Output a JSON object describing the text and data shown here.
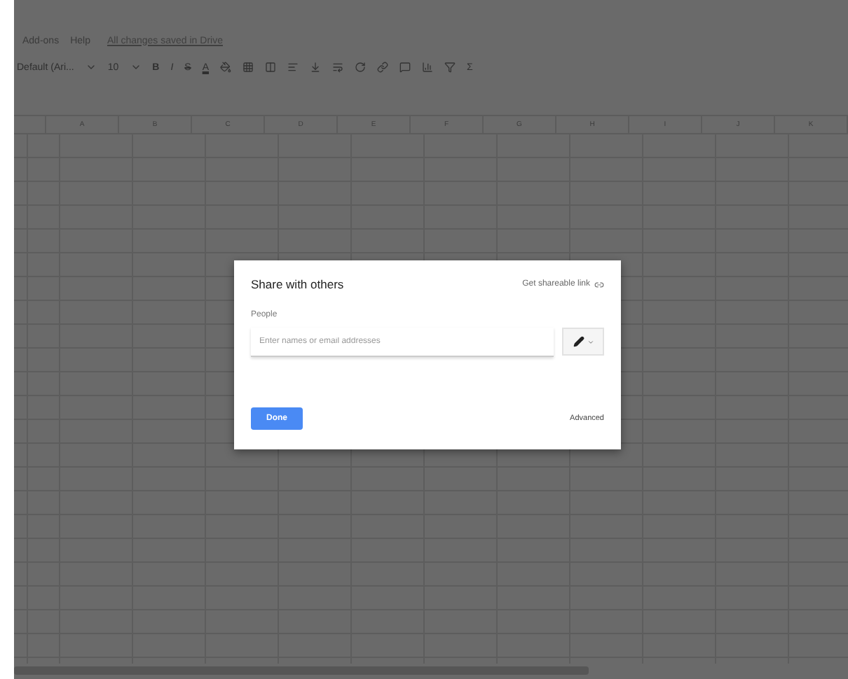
{
  "menu": {
    "items": [
      "Add-ons",
      "Help"
    ],
    "save_status": "All changes saved in Drive"
  },
  "toolbar": {
    "font": "Default (Ari...",
    "font_size": "10",
    "bold": "B",
    "italic": "I",
    "strike": "S",
    "text_color": "A",
    "functions": "Σ"
  },
  "columns": [
    "A",
    "B",
    "C",
    "D",
    "E",
    "F",
    "G",
    "H",
    "I",
    "J",
    "K"
  ],
  "dialog": {
    "title": "Share with others",
    "link_label": "Get shareable link",
    "people_label": "People",
    "placeholder": "Enter names or email addresses",
    "done": "Done",
    "advanced": "Advanced"
  }
}
